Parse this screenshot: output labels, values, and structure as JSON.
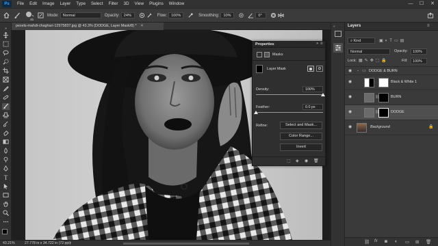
{
  "app": {
    "logo": "Ps"
  },
  "menu": [
    "File",
    "Edit",
    "Image",
    "Layer",
    "Type",
    "Select",
    "Filter",
    "3D",
    "View",
    "Plugins",
    "Window"
  ],
  "window_controls": [
    "—",
    "☐",
    "✕"
  ],
  "options": {
    "brush_size": "45",
    "mode_label": "Mode:",
    "mode_value": "Normal",
    "opacity_label": "Opacity:",
    "opacity_value": "24%",
    "flow_label": "Flow:",
    "flow_value": "100%",
    "smoothing_label": "Smoothing:",
    "smoothing_value": "10%",
    "angle_value": "0°"
  },
  "document": {
    "tab_title": "pexels-mahdi-chaghari-12975837.jpg @ 43.3% (DODGE, Layer Mask/8) *"
  },
  "status": {
    "zoom": "43.21%",
    "info": "27.778 in x 34.722 in (72 ppi)"
  },
  "properties": {
    "title": "Properties",
    "masks_label": "Masks",
    "layer_mask_label": "Layer Mask",
    "density_label": "Density:",
    "density_value": "100%",
    "density_level": 1.0,
    "feather_label": "Feather:",
    "feather_value": "0.0 px",
    "feather_level": 0.0,
    "refine_label": "Refine:",
    "select_mask_button": "Select and Mask...",
    "color_range_button": "Color Range...",
    "invert_button": "Invert"
  },
  "layers": {
    "tab_label": "Layers",
    "kind_label": "Kind",
    "blend_mode": "Normal",
    "opacity_label": "Opacity:",
    "opacity_value": "100%",
    "lock_label": "Lock:",
    "fill_label": "Fill:",
    "fill_value": "100%",
    "group_name": "DODGE & BURN",
    "items": [
      {
        "name": "Black & White 1"
      },
      {
        "name": "BURN"
      },
      {
        "name": "DODGE"
      },
      {
        "name": "Background"
      }
    ],
    "bottom_icons": [
      "link-icon",
      "fx-icon",
      "mask-icon",
      "adjustment-icon",
      "folder-icon",
      "new-layer-icon",
      "trash-icon"
    ]
  },
  "colors": {
    "accent": "#31a8ff",
    "panel": "#3a3a3a",
    "selected_row": "#4f4f4f"
  }
}
